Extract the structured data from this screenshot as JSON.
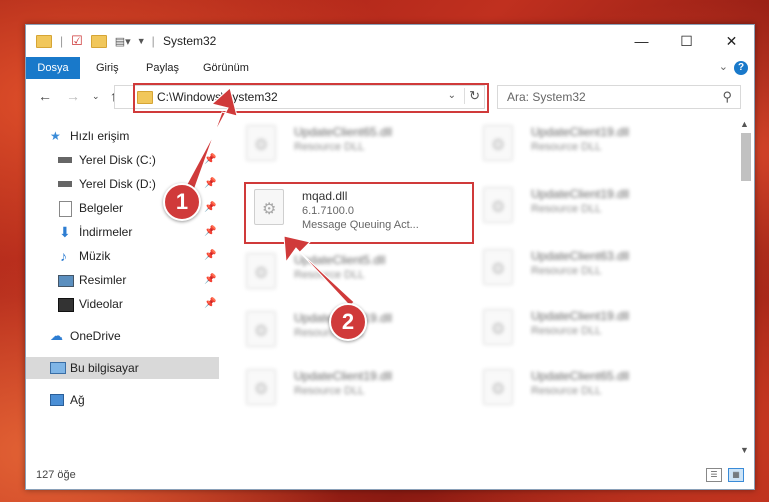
{
  "window": {
    "title": "System32",
    "controls": {
      "minimize": "—",
      "maximize": "☐",
      "close": "✕"
    }
  },
  "ribbon": {
    "tabs": [
      "Dosya",
      "Giriş",
      "Paylaş",
      "Görünüm"
    ],
    "help": "?"
  },
  "address": {
    "path": "C:\\Windows\\System32",
    "search_placeholder": "Ara: System32"
  },
  "sidebar": {
    "quick_access": "Hızlı erişim",
    "items": [
      {
        "label": "Yerel Disk (C:)",
        "icon": "drive-icon"
      },
      {
        "label": "Yerel Disk (D:)",
        "icon": "drive-icon"
      },
      {
        "label": "Belgeler",
        "icon": "documents-icon"
      },
      {
        "label": "İndirmeler",
        "icon": "downloads-icon"
      },
      {
        "label": "Müzik",
        "icon": "music-icon"
      },
      {
        "label": "Resimler",
        "icon": "pictures-icon"
      },
      {
        "label": "Videolar",
        "icon": "videos-icon"
      }
    ],
    "onedrive": "OneDrive",
    "this_pc": "Bu bilgisayar",
    "network": "Ağ"
  },
  "files": {
    "highlight": {
      "name": "mqad.dll",
      "version": "6.1.7100.0",
      "desc": "Message Queuing Act..."
    },
    "left_col": [
      {
        "name": "UpdateClient65.dll",
        "desc": "Resource DLL"
      },
      {
        "name": "UpdateClient5.dll",
        "desc": "Resource DLL"
      },
      {
        "name": "UpdateClient19.dll",
        "desc": "Resource DLL"
      },
      {
        "name": "UpdateClient19.dll",
        "desc": "Resource DLL"
      }
    ],
    "right_col": [
      {
        "name": "UpdateClient19.dll",
        "desc": "Resource DLL"
      },
      {
        "name": "UpdateClient19.dll",
        "desc": "Resource DLL"
      },
      {
        "name": "UpdateClient63.dll",
        "desc": "Resource DLL"
      },
      {
        "name": "UpdateClient19.dll",
        "desc": "Resource DLL"
      },
      {
        "name": "UpdateClient65.dll",
        "desc": "Resource DLL"
      }
    ]
  },
  "status": {
    "count": "127 öğe"
  },
  "callouts": [
    "1",
    "2"
  ],
  "colors": {
    "accent": "#1979ca",
    "highlight_box": "#d03a3a"
  }
}
